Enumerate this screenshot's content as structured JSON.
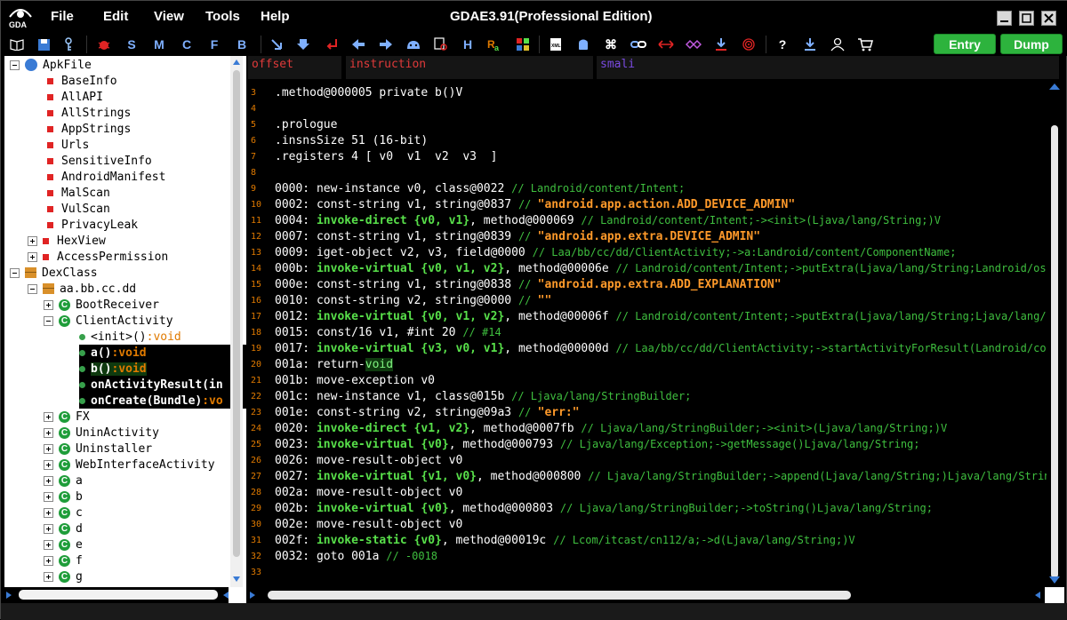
{
  "window": {
    "title": "GDAE3.91(Professional Edition)",
    "logo_text": "GDA"
  },
  "menu": [
    "File",
    "Edit",
    "View",
    "Tools",
    "Help"
  ],
  "toolbar": {
    "letter_buttons": [
      "S",
      "M",
      "C",
      "F",
      "B",
      "H"
    ],
    "entry_label": "Entry",
    "dump_label": "Dump"
  },
  "tree": {
    "root_apk": "ApkFile",
    "apk_items": [
      "BaseInfo",
      "AllAPI",
      "AllStrings",
      "AppStrings",
      "Urls",
      "SensitiveInfo",
      "AndroidManifest",
      "MalScan",
      "VulScan",
      "PrivacyLeak"
    ],
    "apk_expandable": [
      "HexView",
      "AccessPermission"
    ],
    "root_dex": "DexClass",
    "package": "aa.bb.cc.dd",
    "classes_before": [
      "BootReceiver"
    ],
    "expanded_class": "ClientActivity",
    "methods": [
      {
        "name": "<init>()",
        "ret": ":void"
      },
      {
        "name": "a()",
        "ret": ":void"
      },
      {
        "name": "b()",
        "ret": ":void"
      },
      {
        "name": "onActivityResult(in",
        "ret": ""
      },
      {
        "name": "onCreate(Bundle)",
        "ret": ":vo"
      }
    ],
    "classes_after": [
      "FX",
      "UninActivity",
      "Uninstaller",
      "WebInterfaceActivity",
      "a",
      "b",
      "c",
      "d",
      "e",
      "f",
      "g"
    ]
  },
  "code_header": {
    "offset": "offset",
    "instruction": "instruction",
    "smali": "smali"
  },
  "code_lines": [
    {
      "n": "3",
      "parts": [
        {
          "t": ".method@000005 private b()V",
          "c": "code"
        }
      ]
    },
    {
      "n": "4",
      "parts": []
    },
    {
      "n": "5",
      "parts": [
        {
          "t": ".prologue",
          "c": "code"
        }
      ]
    },
    {
      "n": "6",
      "parts": [
        {
          "t": ".insnsSize 51 (16-bit)",
          "c": "code"
        }
      ]
    },
    {
      "n": "7",
      "parts": [
        {
          "t": ".registers 4 [ v0  v1  v2  v3  ]",
          "c": "code"
        }
      ]
    },
    {
      "n": "8",
      "parts": []
    },
    {
      "n": "9",
      "parts": [
        {
          "t": "0000: new-instance v0, class@0022 ",
          "c": "code"
        },
        {
          "t": "// Landroid/content/Intent;",
          "c": "cmt"
        }
      ]
    },
    {
      "n": "10",
      "parts": [
        {
          "t": "0002: const-string v1, string@0837 ",
          "c": "code"
        },
        {
          "t": "// ",
          "c": "cmt"
        },
        {
          "t": "\"android.app.action.ADD_DEVICE_ADMIN\"",
          "c": "str"
        }
      ]
    },
    {
      "n": "11",
      "parts": [
        {
          "t": "0004: ",
          "c": "code"
        },
        {
          "t": "invoke-direct {v0, v1}",
          "c": "kw"
        },
        {
          "t": ", method@000069 ",
          "c": "code"
        },
        {
          "t": "// Landroid/content/Intent;-><init>(Ljava/lang/String;)V",
          "c": "cmt"
        }
      ]
    },
    {
      "n": "12",
      "parts": [
        {
          "t": "0007: const-string v1, string@0839 ",
          "c": "code"
        },
        {
          "t": "// ",
          "c": "cmt"
        },
        {
          "t": "\"android.app.extra.DEVICE_ADMIN\"",
          "c": "str"
        }
      ]
    },
    {
      "n": "13",
      "parts": [
        {
          "t": "0009: iget-object v2, v3, field@0000 ",
          "c": "code"
        },
        {
          "t": "// Laa/bb/cc/dd/ClientActivity;->a:Landroid/content/ComponentName;",
          "c": "cmt"
        }
      ]
    },
    {
      "n": "14",
      "parts": [
        {
          "t": "000b: ",
          "c": "code"
        },
        {
          "t": "invoke-virtual {v0, v1, v2}",
          "c": "kw"
        },
        {
          "t": ", method@00006e ",
          "c": "code"
        },
        {
          "t": "// Landroid/content/Intent;->putExtra(Ljava/lang/String;Landroid/os/",
          "c": "cmt"
        }
      ]
    },
    {
      "n": "15",
      "parts": [
        {
          "t": "000e: const-string v1, string@0838 ",
          "c": "code"
        },
        {
          "t": "// ",
          "c": "cmt"
        },
        {
          "t": "\"android.app.extra.ADD_EXPLANATION\"",
          "c": "str"
        }
      ]
    },
    {
      "n": "16",
      "parts": [
        {
          "t": "0010: const-string v2, string@0000 ",
          "c": "code"
        },
        {
          "t": "// ",
          "c": "cmt"
        },
        {
          "t": "\"\"",
          "c": "str"
        }
      ]
    },
    {
      "n": "17",
      "parts": [
        {
          "t": "0012: ",
          "c": "code"
        },
        {
          "t": "invoke-virtual {v0, v1, v2}",
          "c": "kw"
        },
        {
          "t": ", method@00006f ",
          "c": "code"
        },
        {
          "t": "// Landroid/content/Intent;->putExtra(Ljava/lang/String;Ljava/lang/S",
          "c": "cmt"
        }
      ]
    },
    {
      "n": "18",
      "parts": [
        {
          "t": "0015: const/16 v1, #int 20 ",
          "c": "code"
        },
        {
          "t": "// #14",
          "c": "cmt"
        }
      ]
    },
    {
      "n": "19",
      "parts": [
        {
          "t": "0017: ",
          "c": "code"
        },
        {
          "t": "invoke-virtual {v3, v0, v1}",
          "c": "kw"
        },
        {
          "t": ", method@00000d ",
          "c": "code"
        },
        {
          "t": "// Laa/bb/cc/dd/ClientActivity;->startActivityForResult(Landroid/con",
          "c": "cmt"
        }
      ]
    },
    {
      "n": "20",
      "parts": [
        {
          "t": "001a: return-",
          "c": "code"
        },
        {
          "t": "void",
          "c": "hl"
        }
      ]
    },
    {
      "n": "21",
      "parts": [
        {
          "t": "001b: move-exception v0",
          "c": "code"
        }
      ]
    },
    {
      "n": "22",
      "parts": [
        {
          "t": "001c: new-instance v1, class@015b ",
          "c": "code"
        },
        {
          "t": "// Ljava/lang/StringBuilder;",
          "c": "cmt"
        }
      ]
    },
    {
      "n": "23",
      "parts": [
        {
          "t": "001e: const-string v2, string@09a3 ",
          "c": "code"
        },
        {
          "t": "// ",
          "c": "cmt"
        },
        {
          "t": "\"err:\"",
          "c": "str"
        }
      ]
    },
    {
      "n": "24",
      "parts": [
        {
          "t": "0020: ",
          "c": "code"
        },
        {
          "t": "invoke-direct {v1, v2}",
          "c": "kw"
        },
        {
          "t": ", method@0007fb ",
          "c": "code"
        },
        {
          "t": "// Ljava/lang/StringBuilder;-><init>(Ljava/lang/String;)V",
          "c": "cmt"
        }
      ]
    },
    {
      "n": "25",
      "parts": [
        {
          "t": "0023: ",
          "c": "code"
        },
        {
          "t": "invoke-virtual {v0}",
          "c": "kw"
        },
        {
          "t": ", method@000793 ",
          "c": "code"
        },
        {
          "t": "// Ljava/lang/Exception;->getMessage()Ljava/lang/String;",
          "c": "cmt"
        }
      ]
    },
    {
      "n": "26",
      "parts": [
        {
          "t": "0026: move-result-object v0",
          "c": "code"
        }
      ]
    },
    {
      "n": "27",
      "parts": [
        {
          "t": "0027: ",
          "c": "code"
        },
        {
          "t": "invoke-virtual {v1, v0}",
          "c": "kw"
        },
        {
          "t": ", method@000800 ",
          "c": "code"
        },
        {
          "t": "// Ljava/lang/StringBuilder;->append(Ljava/lang/String;)Ljava/lang/Strin",
          "c": "cmt"
        }
      ]
    },
    {
      "n": "28",
      "parts": [
        {
          "t": "002a: move-result-object v0",
          "c": "code"
        }
      ]
    },
    {
      "n": "29",
      "parts": [
        {
          "t": "002b: ",
          "c": "code"
        },
        {
          "t": "invoke-virtual {v0}",
          "c": "kw"
        },
        {
          "t": ", method@000803 ",
          "c": "code"
        },
        {
          "t": "// Ljava/lang/StringBuilder;->toString()Ljava/lang/String;",
          "c": "cmt"
        }
      ]
    },
    {
      "n": "30",
      "parts": [
        {
          "t": "002e: move-result-object v0",
          "c": "code"
        }
      ]
    },
    {
      "n": "31",
      "parts": [
        {
          "t": "002f: ",
          "c": "code"
        },
        {
          "t": "invoke-static {v0}",
          "c": "kw"
        },
        {
          "t": ", method@00019c ",
          "c": "code"
        },
        {
          "t": "// Lcom/itcast/cn112/a;->d(Ljava/lang/String;)V",
          "c": "cmt"
        }
      ]
    },
    {
      "n": "32",
      "parts": [
        {
          "t": "0032: goto 001a ",
          "c": "code"
        },
        {
          "t": "// -0018",
          "c": "cmt"
        }
      ]
    },
    {
      "n": "33",
      "parts": []
    }
  ],
  "colors": {
    "keyword": "#58e04a",
    "string": "#ff9a2a",
    "comment": "#3fbf3f",
    "line_number": "#e07a00",
    "header_offset": "#e03a3a",
    "header_instruction": "#e03a3a",
    "header_smali": "#7a4ae0",
    "entry_dump_button": "#2db33d"
  }
}
